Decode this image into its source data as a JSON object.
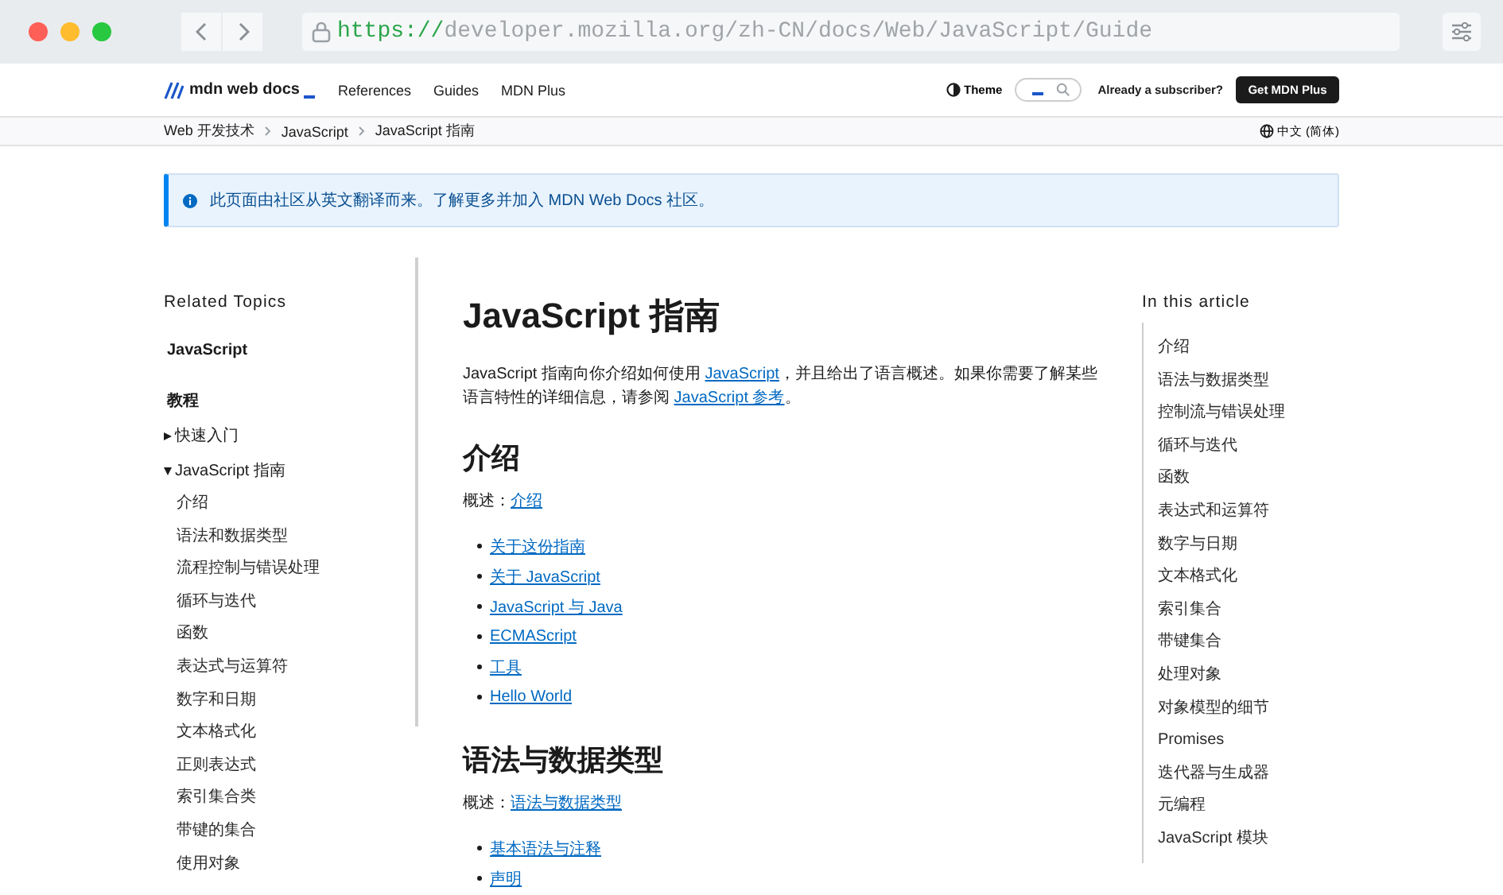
{
  "browser": {
    "url_scheme": "https://",
    "url_rest": "developer.mozilla.org/zh-CN/docs/Web/JavaScript/Guide"
  },
  "header": {
    "logo": "mdn web docs",
    "nav": [
      "References",
      "Guides",
      "MDN Plus"
    ],
    "theme": "Theme",
    "subscriber": "Already a subscriber?",
    "cta": "Get MDN Plus"
  },
  "breadcrumbs": [
    "Web 开发技术",
    "JavaScript",
    "JavaScript 指南"
  ],
  "language": "中文 (简体)",
  "notice": "此页面由社区从英文翻译而来。了解更多并加入 MDN Web Docs 社区。",
  "sidebar": {
    "title": "Related Topics",
    "root": "JavaScript",
    "section": "教程",
    "tree": [
      {
        "label": "快速入门",
        "expanded": false
      },
      {
        "label": "JavaScript 指南",
        "expanded": true,
        "children": [
          "介绍",
          "语法和数据类型",
          "流程控制与错误处理",
          "循环与迭代",
          "函数",
          "表达式与运算符",
          "数字和日期",
          "文本格式化",
          "正则表达式",
          "索引集合类",
          "带键的集合",
          "使用对象"
        ]
      }
    ]
  },
  "article": {
    "title": "JavaScript 指南",
    "intro": [
      {
        "kind": "text",
        "text": "JavaScript 指南向你介绍如何使用 "
      },
      {
        "kind": "link",
        "text": "JavaScript"
      },
      {
        "kind": "text",
        "text": "，并且给出了语言概述。如果你需要了解某些语言特性的详细信息，请参阅 "
      },
      {
        "kind": "link",
        "text": "JavaScript 参考"
      },
      {
        "kind": "text",
        "text": "。"
      }
    ],
    "sections": [
      {
        "heading": "介绍",
        "overview_label": "概述：",
        "overview_link": "介绍",
        "links": [
          "关于这份指南",
          "关于 JavaScript",
          "JavaScript 与 Java",
          "ECMAScript",
          "工具",
          "Hello World"
        ]
      },
      {
        "heading": "语法与数据类型",
        "overview_label": "概述：",
        "overview_link": "语法与数据类型",
        "links": [
          "基本语法与注释",
          "声明"
        ]
      }
    ]
  },
  "toc": {
    "title": "In this article",
    "items": [
      "介绍",
      "语法与数据类型",
      "控制流与错误处理",
      "循环与迭代",
      "函数",
      "表达式和运算符",
      "数字与日期",
      "文本格式化",
      "索引集合",
      "带键集合",
      "处理对象",
      "对象模型的细节",
      "Promises",
      "迭代器与生成器",
      "元编程",
      "JavaScript 模块"
    ]
  }
}
